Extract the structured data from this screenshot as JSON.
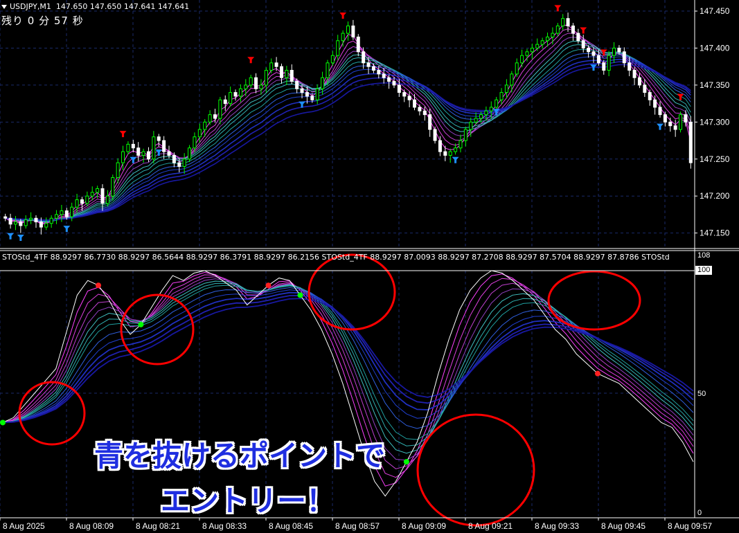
{
  "header": {
    "symbol": "USDJPY,M1",
    "prices": "147.650 147.650 147.641 147.641",
    "countdown": "残り 0 分 57 秒"
  },
  "price_axis": {
    "labels": [
      "147.450",
      "147.400",
      "147.350",
      "147.300",
      "147.250",
      "147.200",
      "147.150"
    ],
    "ylim": [
      147.13,
      147.465
    ]
  },
  "indicator": {
    "header": "STOStd_4TF 88.9297 86.7730 88.9297 86.5644 88.9297 86.3791 88.9297 86.2156   STOStd_4TF 88.9297 87.0093 88.9297 87.2708 88.9297 87.5704 88.9297 87.8786   STOStd",
    "axis_labels": [
      "108",
      "100",
      "50",
      "0"
    ],
    "ylim": [
      0,
      108
    ]
  },
  "time_axis": {
    "labels": [
      "8 Aug 2025",
      "8 Aug 08:09",
      "8 Aug 08:21",
      "8 Aug 08:33",
      "8 Aug 08:45",
      "8 Aug 08:57",
      "8 Aug 09:09",
      "8 Aug 09:21",
      "8 Aug 09:33",
      "8 Aug 09:45",
      "8 Aug 09:57"
    ]
  },
  "overlay_text": {
    "line1": "青を抜けるポイントで",
    "line2": "エントリー！"
  },
  "colors": {
    "bull": "#00ff00",
    "bear": "#ffffff",
    "up_arrow": "#1e90ff",
    "down_arrow": "#ff0000",
    "grid": "#1a2a6a",
    "circle": "#ff0000",
    "overlay_fill": "#1f2ee0"
  },
  "chart_data": [
    {
      "type": "candlestick",
      "title": "USDJPY,M1",
      "ylim": [
        147.13,
        147.465
      ],
      "close": [
        147.17,
        147.162,
        147.165,
        147.16,
        147.168,
        147.17,
        147.165,
        147.158,
        147.163,
        147.17,
        147.175,
        147.18,
        147.172,
        147.185,
        147.195,
        147.19,
        147.2,
        147.205,
        147.21,
        147.19,
        147.2,
        147.225,
        147.245,
        147.26,
        147.27,
        147.265,
        147.255,
        147.26,
        147.25,
        147.28,
        147.275,
        147.26,
        147.255,
        147.245,
        147.24,
        147.25,
        147.265,
        147.28,
        147.29,
        147.3,
        147.31,
        147.305,
        147.33,
        147.325,
        147.34,
        147.335,
        147.345,
        147.35,
        147.36,
        147.345,
        147.35,
        147.37,
        147.38,
        147.375,
        147.36,
        147.37,
        147.355,
        147.345,
        147.34,
        147.335,
        147.33,
        147.345,
        147.36,
        147.38,
        147.39,
        147.41,
        147.42,
        147.43,
        147.415,
        147.395,
        147.38,
        147.375,
        147.37,
        147.365,
        147.36,
        147.355,
        147.35,
        147.34,
        147.335,
        147.33,
        147.32,
        147.315,
        147.31,
        147.29,
        147.275,
        147.26,
        147.255,
        147.26,
        147.265,
        147.275,
        147.29,
        147.3,
        147.305,
        147.31,
        147.315,
        147.32,
        147.33,
        147.34,
        147.35,
        147.365,
        147.38,
        147.39,
        147.395,
        147.4,
        147.405,
        147.41,
        147.415,
        147.42,
        147.43,
        147.44,
        147.43,
        147.42,
        147.41,
        147.4,
        147.395,
        147.39,
        147.38,
        147.37,
        147.39,
        147.4,
        147.395,
        147.38,
        147.37,
        147.36,
        147.35,
        147.34,
        147.33,
        147.32,
        147.31,
        147.3,
        147.295,
        147.29,
        147.31,
        147.3,
        147.245
      ]
    },
    {
      "type": "line",
      "title": "STOStd_4TF",
      "ylim": [
        0,
        108
      ],
      "values": [
        38,
        40,
        45,
        50,
        55,
        60,
        75,
        90,
        96,
        94,
        88,
        80,
        74,
        78,
        85,
        92,
        98,
        96,
        99,
        100,
        98,
        95,
        92,
        86,
        90,
        94,
        97,
        96,
        90,
        84,
        76,
        66,
        54,
        40,
        26,
        14,
        8,
        14,
        22,
        30,
        42,
        58,
        72,
        84,
        92,
        97,
        100,
        99,
        96,
        92,
        88,
        82,
        76,
        72,
        66,
        62,
        58,
        56,
        54,
        50,
        46,
        42,
        38,
        36,
        30,
        22
      ]
    }
  ]
}
